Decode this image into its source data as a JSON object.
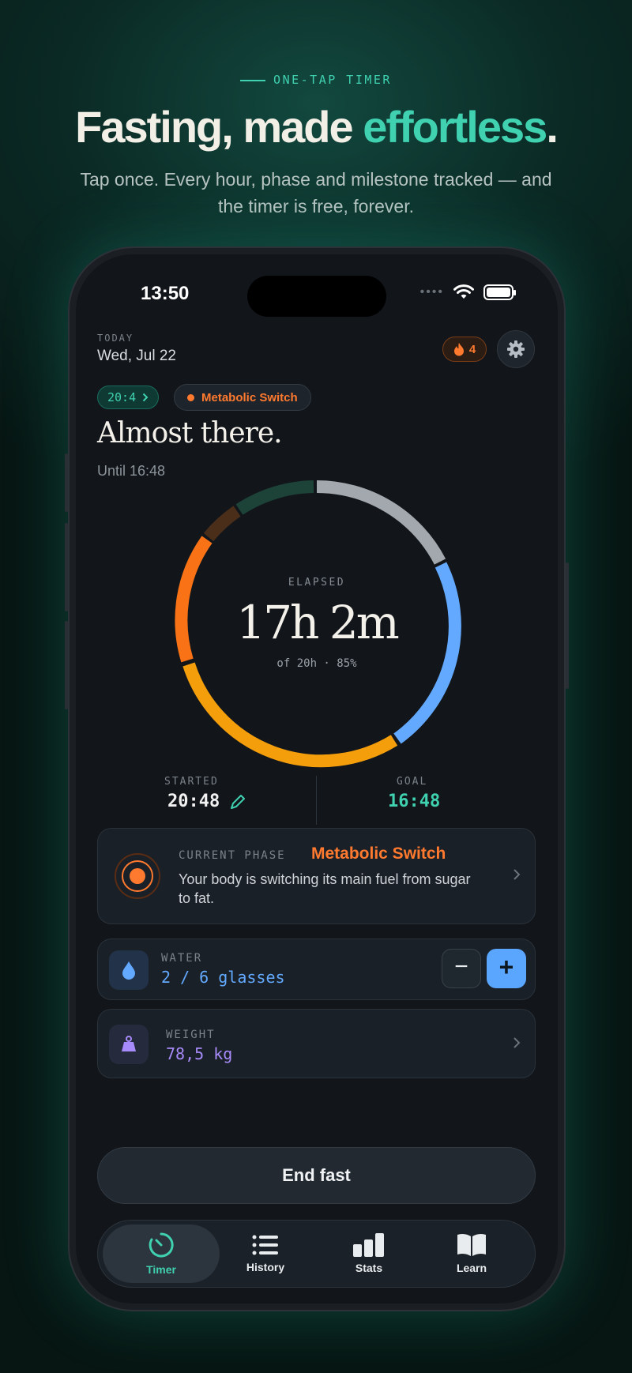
{
  "promo": {
    "eyebrow": "ONE-TAP TIMER",
    "headline_part1": "Fasting, made ",
    "headline_accent": "effortless",
    "headline_end": ".",
    "subhead": "Tap once. Every hour, phase and milestone tracked — and the timer is free, forever."
  },
  "status_bar": {
    "time": "13:50",
    "signal": "••••"
  },
  "header": {
    "today_label": "TODAY",
    "date": "Wed, Jul 22",
    "streak_count": "4"
  },
  "plan": {
    "ratio": "20:4",
    "phase_chip": "Metabolic Switch",
    "status_title": "Almost there.",
    "until": "Until 16:48"
  },
  "timer": {
    "elapsed_label": "ELAPSED",
    "elapsed_value": "17h 2m",
    "elapsed_sub": "of 20h · 85%",
    "progress_percent": 85
  },
  "times": {
    "started_label": "STARTED",
    "started_value": "20:48",
    "goal_label": "GOAL",
    "goal_value": "16:48"
  },
  "phase_card": {
    "kicker": "CURRENT PHASE",
    "name": "Metabolic Switch",
    "description": "Your body is switching its main fuel from sugar to fat."
  },
  "water": {
    "label": "WATER",
    "value": "2 / 6 glasses",
    "minus": "−",
    "plus": "+"
  },
  "weight": {
    "label": "WEIGHT",
    "value": "78,5 kg"
  },
  "end_button": "End fast",
  "tabs": [
    {
      "label": "Timer",
      "icon": "timer-icon",
      "active": true
    },
    {
      "label": "History",
      "icon": "list-icon"
    },
    {
      "label": "Stats",
      "icon": "bar-chart-icon"
    },
    {
      "label": "Learn",
      "icon": "book-icon"
    }
  ],
  "colors": {
    "accent": "#3fd1b0",
    "phase_orange": "#ff7a2f",
    "water_blue": "#62a9ff",
    "weight_purple": "#a78bfa"
  }
}
